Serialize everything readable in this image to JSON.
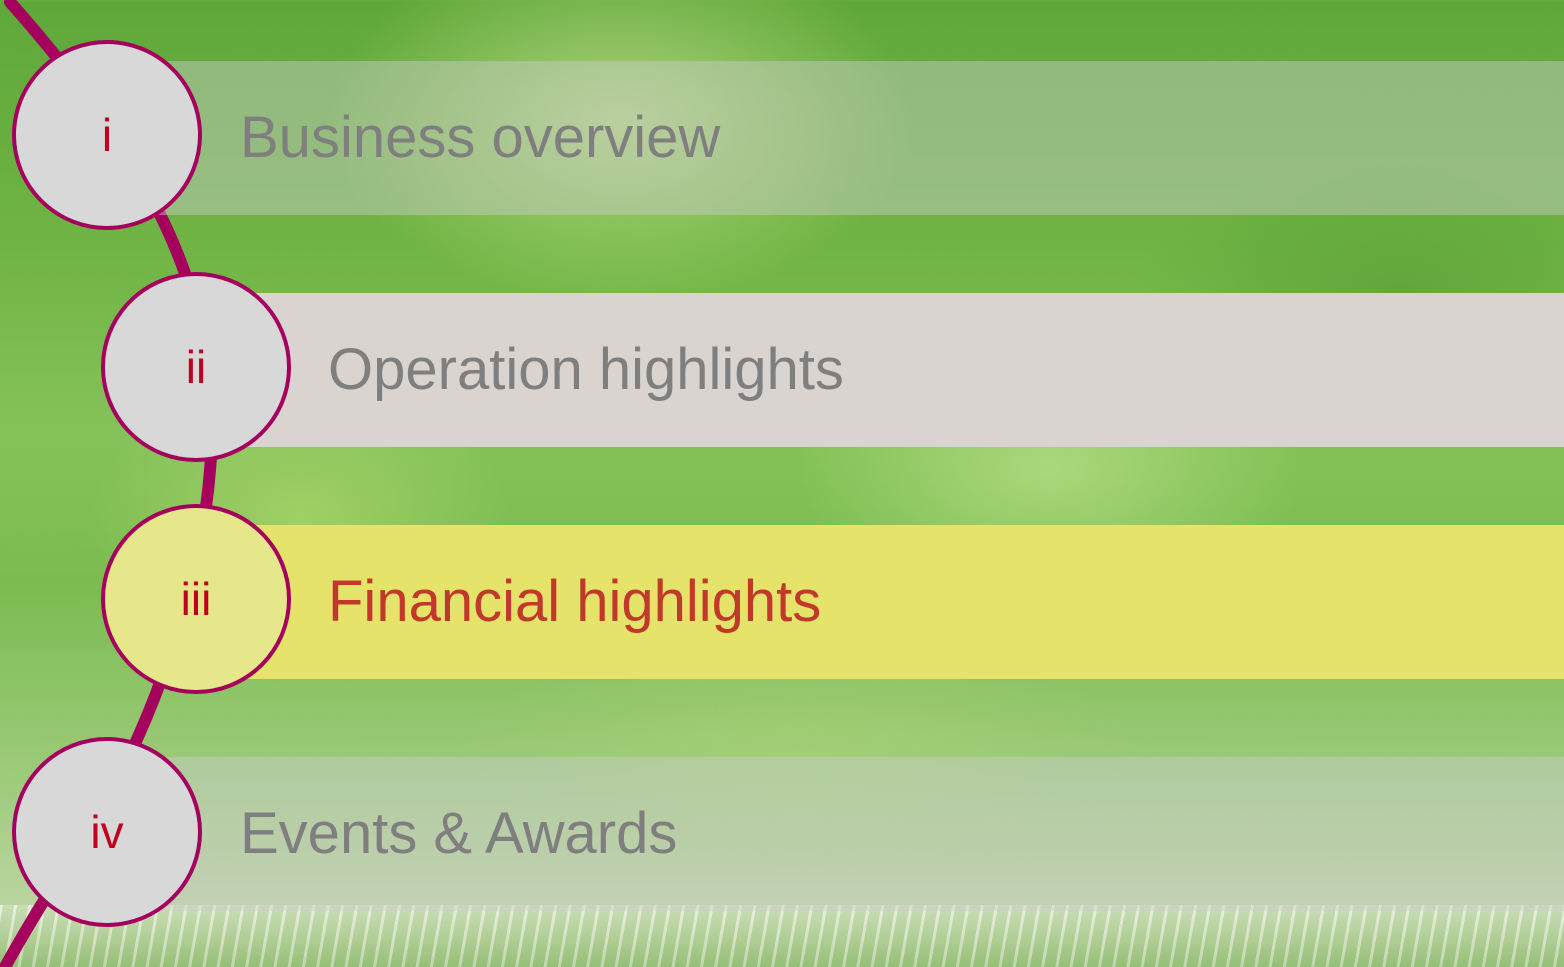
{
  "agenda": {
    "items": [
      {
        "number": "i",
        "label": "Business overview",
        "state": "inactive"
      },
      {
        "number": "ii",
        "label": "Operation highlights",
        "state": "inactive"
      },
      {
        "number": "iii",
        "label": "Financial highlights",
        "state": "active"
      },
      {
        "number": "iv",
        "label": "Events & Awards",
        "state": "inactive"
      }
    ]
  },
  "colors": {
    "accent_line": "#a5005e",
    "number_text": "#c0001f",
    "active_label": "#c0392b",
    "inactive_label": "#7f7f7f",
    "active_bar": "#e6e36a",
    "inactive_bar": "#d9d4cf"
  }
}
